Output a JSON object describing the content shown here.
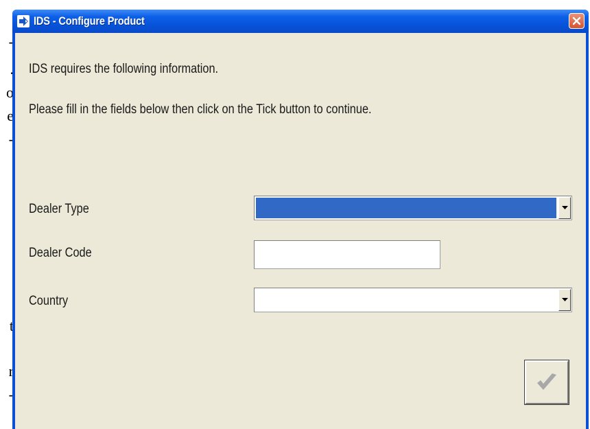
{
  "background_text": [
    "-",
    ".",
    "o",
    "e",
    "-",
    "t",
    "r",
    "-"
  ],
  "window": {
    "title": "IDS - Configure Product",
    "icons": {
      "app": "ids-logo-icon",
      "close": "close-icon"
    }
  },
  "messages": {
    "line1": "IDS requires the following information.",
    "line2": "Please fill in the fields below then click on the Tick button to continue."
  },
  "form": {
    "dealer_type": {
      "label": "Dealer Type",
      "value": "",
      "highlighted": true,
      "highlight_color": "#3169c6"
    },
    "dealer_code": {
      "label": "Dealer Code",
      "value": ""
    },
    "country": {
      "label": "Country",
      "value": ""
    }
  },
  "tick_button": {
    "icon": "checkmark-icon",
    "enabled": false
  },
  "colors": {
    "titlebar": "#0652d8",
    "dialog_bg": "#ece9d8",
    "selection": "#3169c6",
    "close_button": "#d6542f",
    "disabled_tick": "#a8a8a8"
  }
}
